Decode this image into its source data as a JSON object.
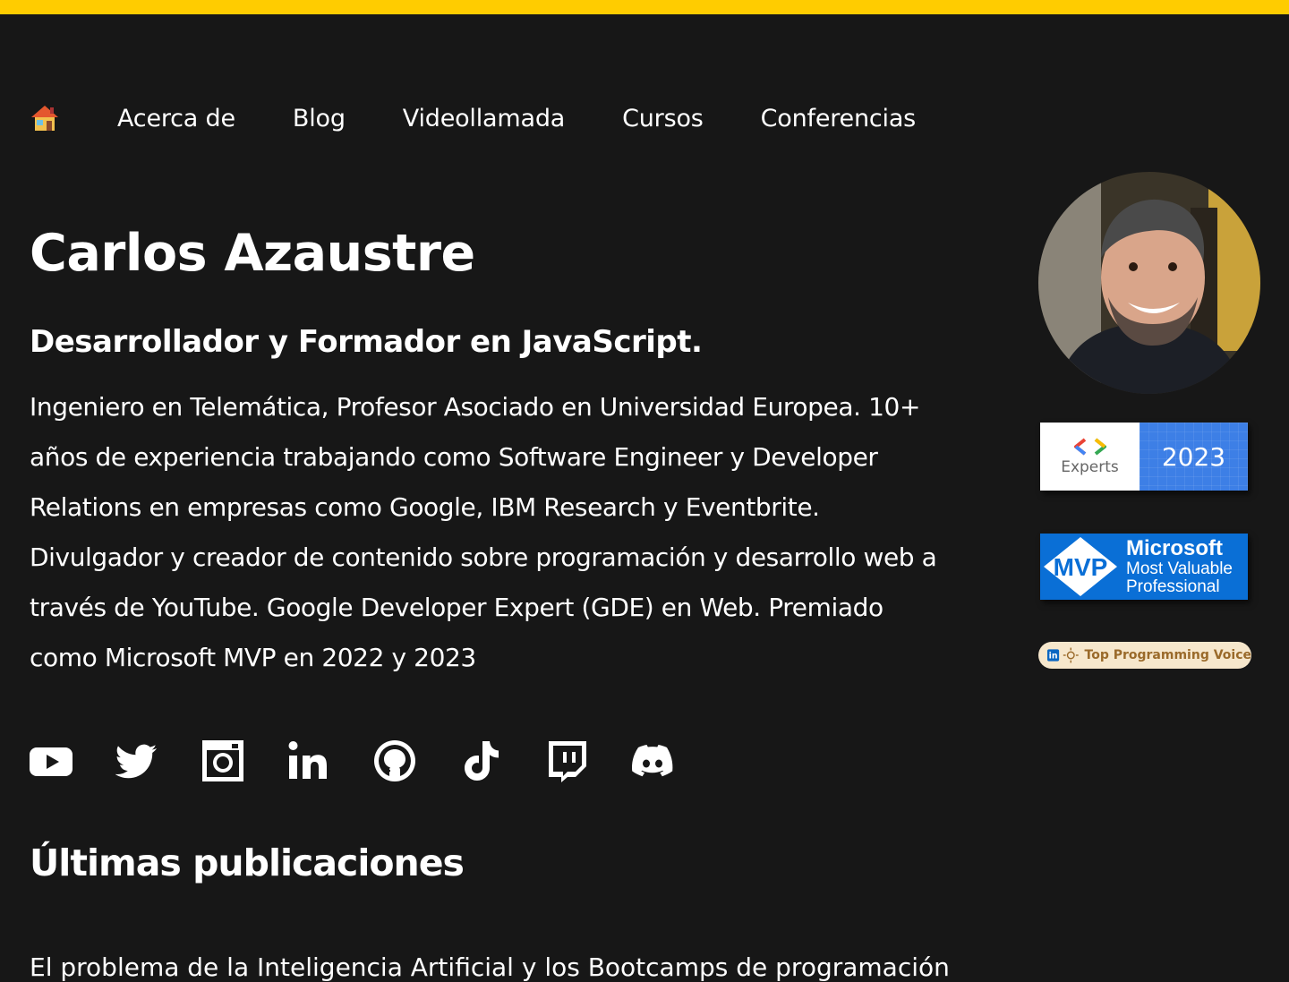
{
  "colors": {
    "accent": "#ffcc00",
    "background": "#171717",
    "text": "#ffffff"
  },
  "nav": {
    "home_icon": "house-emoji-icon",
    "items": [
      {
        "label": "Acerca de"
      },
      {
        "label": "Blog"
      },
      {
        "label": "Videollamada"
      },
      {
        "label": "Cursos"
      },
      {
        "label": "Conferencias"
      }
    ]
  },
  "hero": {
    "name": "Carlos Azaustre",
    "subtitle": "Desarrollador y Formador en JavaScript.",
    "bio": "Ingeniero en Telemática, Profesor Asociado en Universidad Europea. 10+ años de experiencia trabajando como Software Engineer y Developer Relations en empresas como Google, IBM Research y Eventbrite. Divulgador y creador de contenido sobre programación y desarrollo web a través de YouTube. Google Developer Expert (GDE) en Web. Premiado como Microsoft MVP en 2022 y 2023"
  },
  "badges": {
    "gde": {
      "left": "Experts",
      "year": "2023"
    },
    "mvp": {
      "logo": "MVP",
      "brand": "Microsoft",
      "line1": "Most Valuable",
      "line2": "Professional"
    },
    "linkedin": {
      "label": "Top Programming Voice"
    }
  },
  "socials": [
    "youtube-icon",
    "twitter-icon",
    "instagram-icon",
    "linkedin-icon",
    "github-icon",
    "tiktok-icon",
    "twitch-icon",
    "discord-icon"
  ],
  "latest": {
    "heading": "Últimas publicaciones",
    "teaser": "El problema de la Inteligencia Artificial y los Bootcamps de programación"
  }
}
